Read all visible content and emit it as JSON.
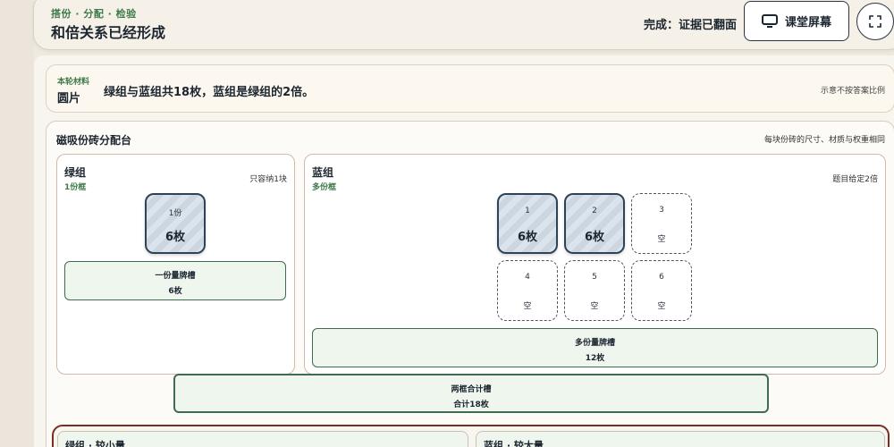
{
  "header": {
    "subtitle": "搭份 · 分配 · 检验",
    "title": "和倍关系已经形成",
    "status": "完成：证据已翻面",
    "screen_button_label": "课堂屏幕"
  },
  "material": {
    "label": "本轮材料",
    "name": "圆片",
    "problem": "绿组与蓝组共18枚，蓝组是绿组的2倍。",
    "note": "示意不按答案比例"
  },
  "board": {
    "title": "磁吸份砖分配台",
    "note": "每块份砖的尺寸、材质与权重相同",
    "green": {
      "name": "绿组",
      "type": "1份框",
      "note": "只容纳1块",
      "tile": {
        "num": "1份",
        "value": "6枚"
      },
      "slot": {
        "title": "一份量牌槽",
        "value": "6枚"
      }
    },
    "blue": {
      "name": "蓝组",
      "type": "多份框",
      "note": "题目给定2倍",
      "tiles": [
        {
          "num": "1",
          "value": "6枚"
        },
        {
          "num": "2",
          "value": "6枚"
        },
        {
          "num": "3",
          "value": "空"
        },
        {
          "num": "4",
          "value": "空"
        },
        {
          "num": "5",
          "value": "空"
        },
        {
          "num": "6",
          "value": "空"
        }
      ],
      "slot": {
        "title": "多份量牌槽",
        "value": "12枚"
      }
    },
    "total_slot": {
      "title": "两框合计槽",
      "value": "合计18枚"
    }
  },
  "comparison": {
    "left": "绿组 · 较小量",
    "right": "蓝组 · 较大量"
  },
  "colors": {
    "accent_green": "#3f7a4a",
    "tile_border": "#2f4357",
    "comparison_border": "#7a2e23"
  }
}
